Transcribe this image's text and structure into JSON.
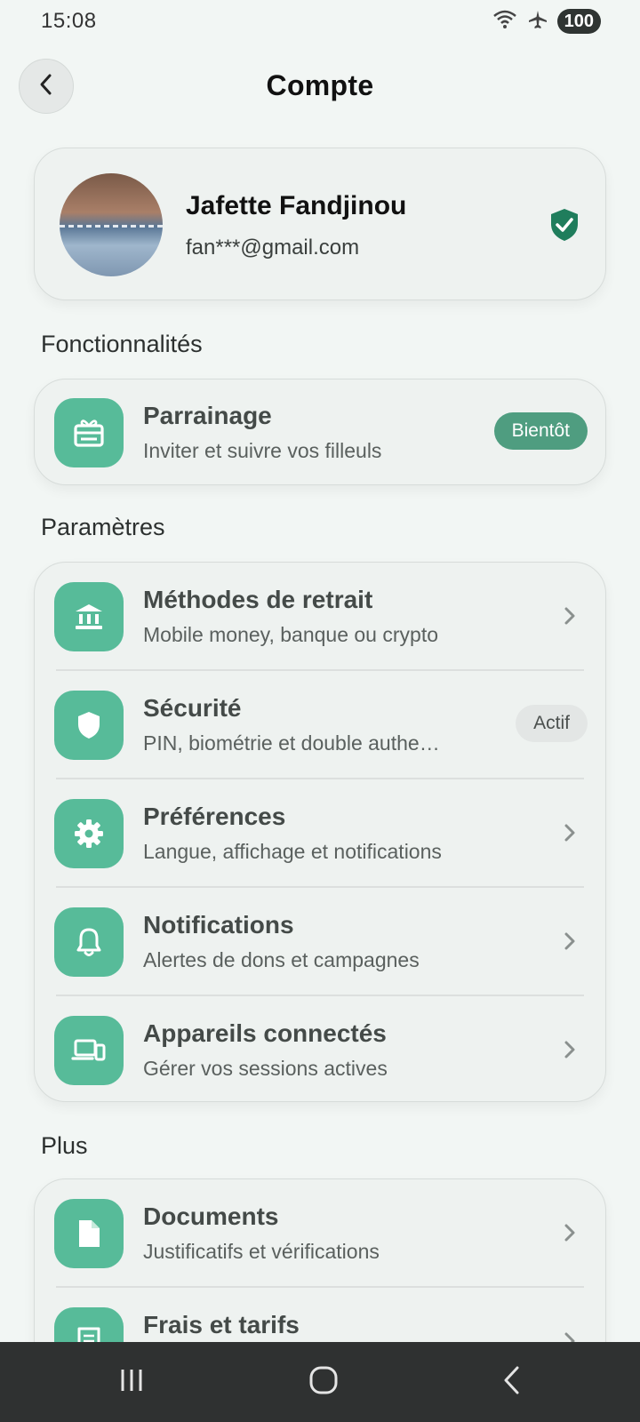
{
  "status": {
    "time": "15:08",
    "battery": "100"
  },
  "header": {
    "title": "Compte"
  },
  "profile": {
    "name": "Jafette Fandjinou",
    "email": "fan***@gmail.com"
  },
  "sections": {
    "features": {
      "title": "Fonctionnalités",
      "items": [
        {
          "title": "Parrainage",
          "subtitle": "Inviter et suivre vos filleuls",
          "badge": "Bientôt",
          "icon": "gift-icon"
        }
      ]
    },
    "settings": {
      "title": "Paramètres",
      "items": [
        {
          "title": "Méthodes de retrait",
          "subtitle": "Mobile money, banque ou crypto",
          "icon": "bank-icon"
        },
        {
          "title": "Sécurité",
          "subtitle": "PIN, biométrie et double authe…",
          "badge": "Actif",
          "icon": "shield-icon"
        },
        {
          "title": "Préférences",
          "subtitle": "Langue, affichage et notifications",
          "icon": "gear-icon"
        },
        {
          "title": "Notifications",
          "subtitle": "Alertes de dons et campagnes",
          "icon": "bell-icon"
        },
        {
          "title": "Appareils connectés",
          "subtitle": "Gérer vos sessions actives",
          "icon": "devices-icon"
        }
      ]
    },
    "more": {
      "title": "Plus",
      "items": [
        {
          "title": "Documents",
          "subtitle": "Justificatifs et vérifications",
          "icon": "document-icon"
        },
        {
          "title": "Frais et tarifs",
          "subtitle": "",
          "icon": "receipt-icon"
        }
      ]
    }
  },
  "colors": {
    "accent": "#57bb99",
    "badge_green": "#4f9d80",
    "background": "#f2f6f4"
  }
}
